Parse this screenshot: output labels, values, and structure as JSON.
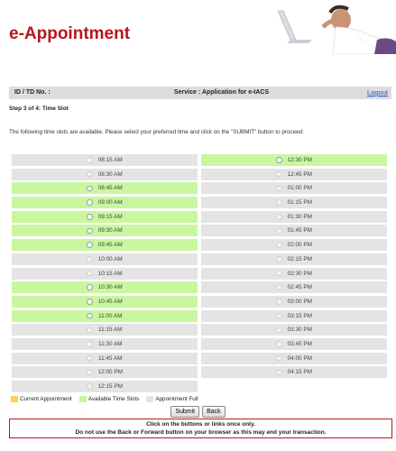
{
  "header": {
    "app_title": "e-Appointment"
  },
  "infobar": {
    "id_label": "ID / TD No. :",
    "service": "Service : Application for e-IACS",
    "logout": "Logout"
  },
  "step": "Step 3 of 4: Time Slot",
  "instructions": "The following time slots are available. Please select your preferred time and click on the \"SUBMIT\" button to proceed:",
  "slots": {
    "left": [
      {
        "time": "08:15 AM",
        "status": "full"
      },
      {
        "time": "08:30 AM",
        "status": "full"
      },
      {
        "time": "08:45 AM",
        "status": "available"
      },
      {
        "time": "09:00 AM",
        "status": "available"
      },
      {
        "time": "09:15 AM",
        "status": "available"
      },
      {
        "time": "09:30 AM",
        "status": "available"
      },
      {
        "time": "09:45 AM",
        "status": "available"
      },
      {
        "time": "10:00 AM",
        "status": "full"
      },
      {
        "time": "10:15 AM",
        "status": "full"
      },
      {
        "time": "10:30 AM",
        "status": "available"
      },
      {
        "time": "10:45 AM",
        "status": "available"
      },
      {
        "time": "11:00 AM",
        "status": "available"
      },
      {
        "time": "11:15 AM",
        "status": "full"
      },
      {
        "time": "11:30 AM",
        "status": "full"
      },
      {
        "time": "11:45 AM",
        "status": "full"
      },
      {
        "time": "12:00 PM",
        "status": "full"
      },
      {
        "time": "12:15 PM",
        "status": "full"
      }
    ],
    "right": [
      {
        "time": "12:30 PM",
        "status": "available"
      },
      {
        "time": "12:45 PM",
        "status": "full"
      },
      {
        "time": "01:00 PM",
        "status": "full"
      },
      {
        "time": "01:15 PM",
        "status": "full"
      },
      {
        "time": "01:30 PM",
        "status": "full"
      },
      {
        "time": "01:45 PM",
        "status": "full"
      },
      {
        "time": "02:00 PM",
        "status": "full"
      },
      {
        "time": "02:15 PM",
        "status": "full"
      },
      {
        "time": "02:30 PM",
        "status": "full"
      },
      {
        "time": "02:45 PM",
        "status": "full"
      },
      {
        "time": "03:00 PM",
        "status": "full"
      },
      {
        "time": "03:15 PM",
        "status": "full"
      },
      {
        "time": "03:30 PM",
        "status": "full"
      },
      {
        "time": "03:45 PM",
        "status": "full"
      },
      {
        "time": "04:00 PM",
        "status": "full"
      },
      {
        "time": "04:15 PM",
        "status": "full"
      }
    ]
  },
  "legend": {
    "current": "Current Appointment",
    "available": "Available Time Slots",
    "full": "Appointment Full"
  },
  "buttons": {
    "submit": "Submit",
    "back": "Back"
  },
  "warning": {
    "line1": "Click on the buttons or links once only.",
    "line2": "Do not use the Back or Forward button on your browser as this may end your transaction."
  },
  "colors": {
    "brand": "#b8141c",
    "available": "#c8f7a0",
    "full": "#e4e4e4",
    "current": "#ffd24a"
  }
}
